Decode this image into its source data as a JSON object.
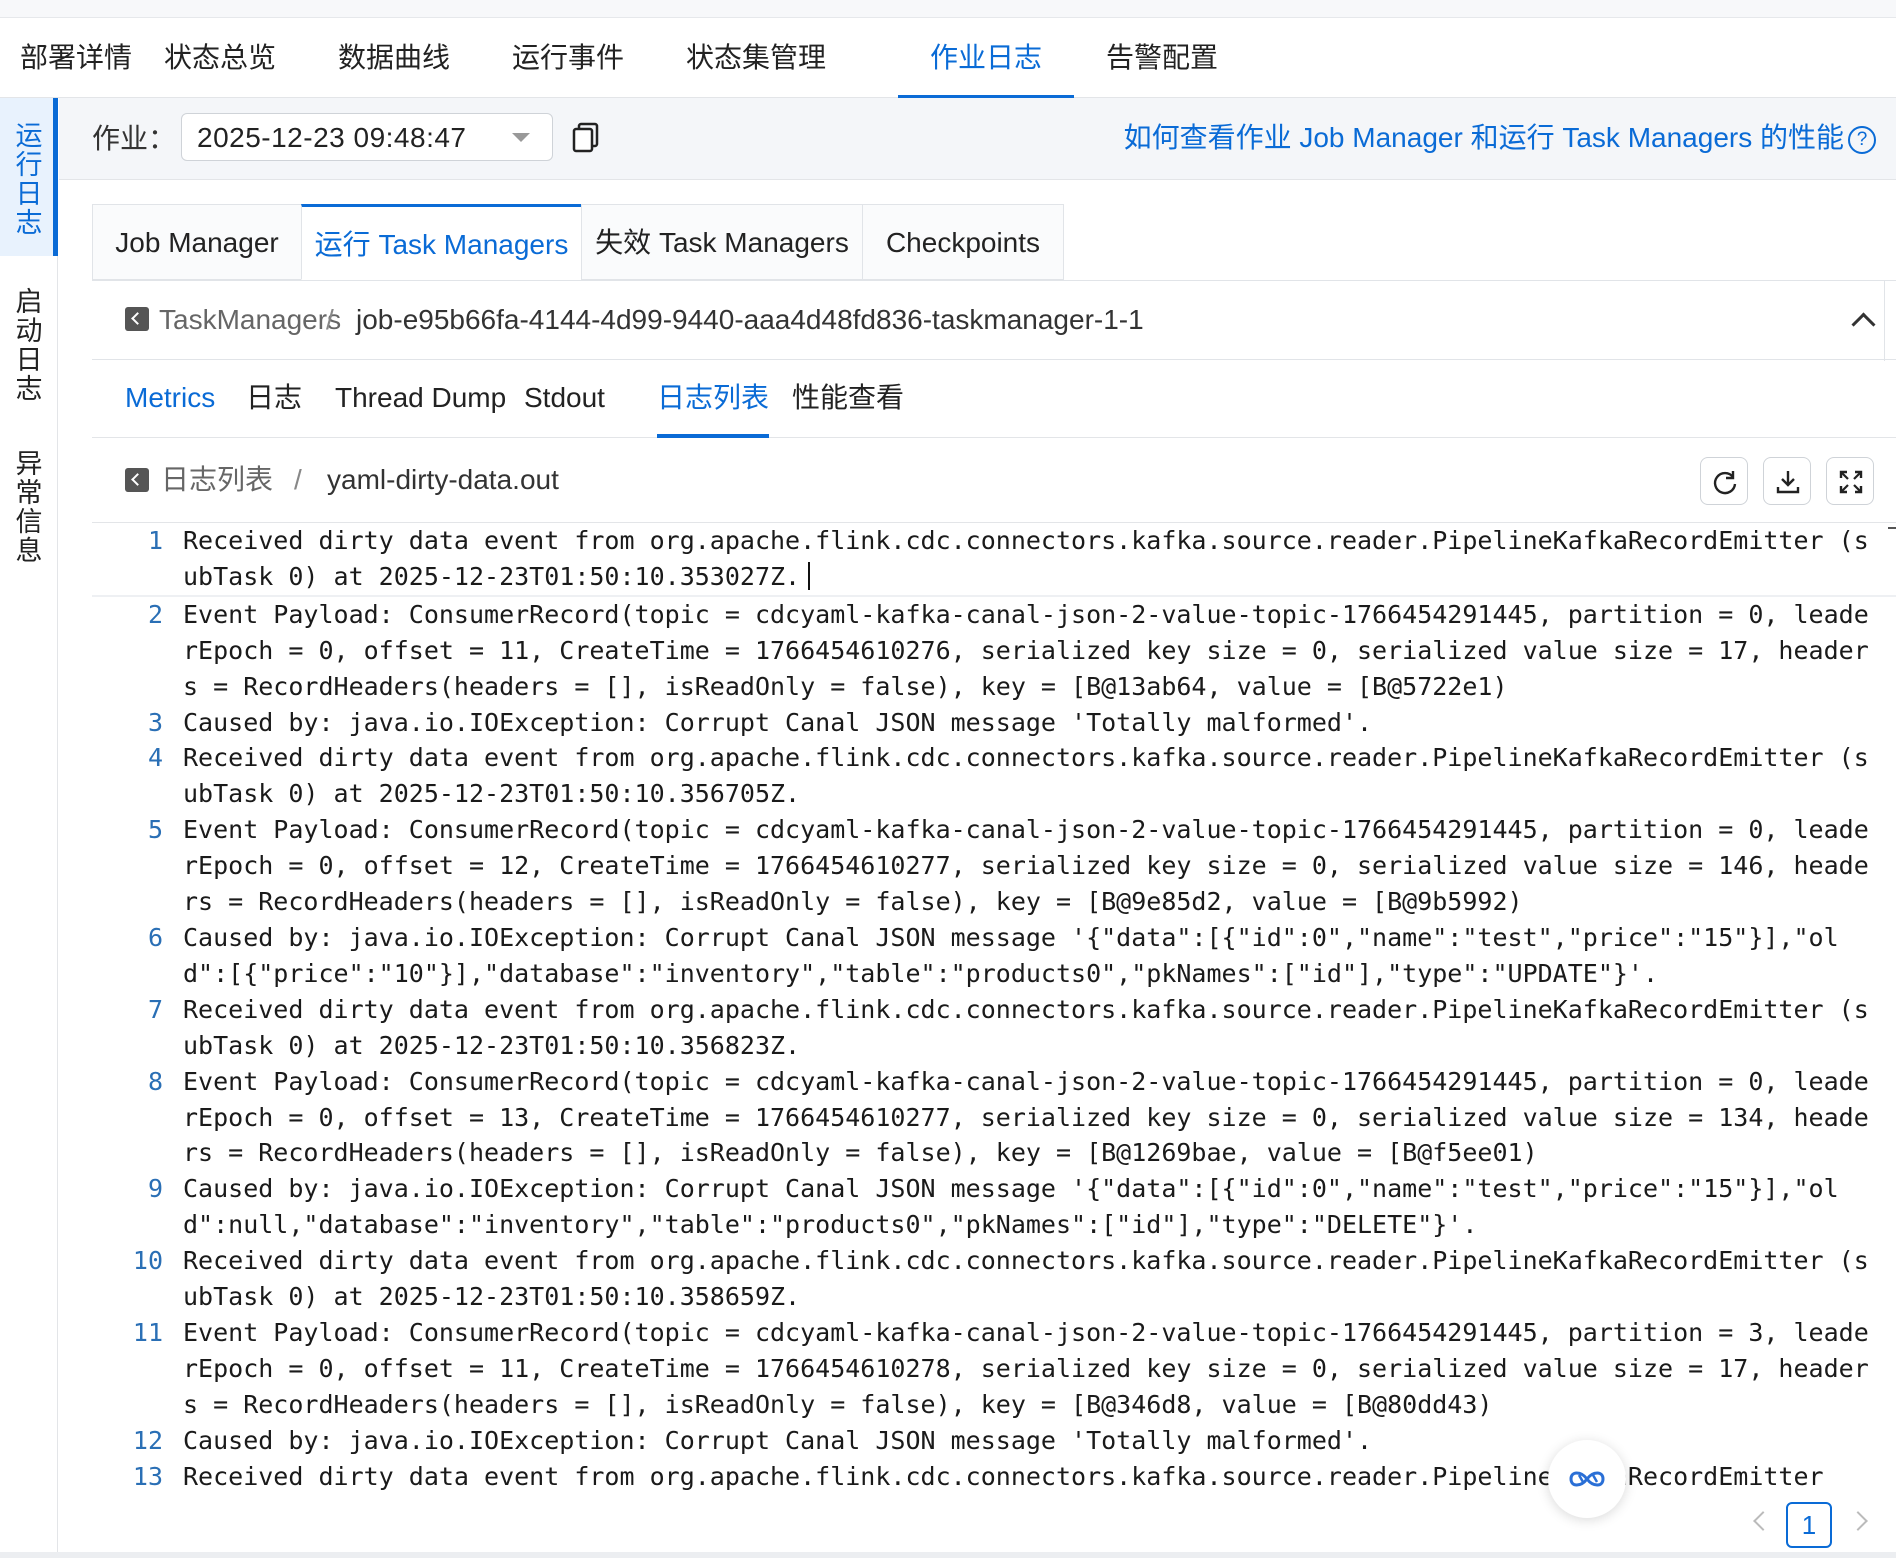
{
  "top_nav": {
    "items": [
      {
        "label": "部署详情"
      },
      {
        "label": "状态总览"
      },
      {
        "label": "数据曲线"
      },
      {
        "label": "运行事件"
      },
      {
        "label": "状态集管理"
      },
      {
        "label": "作业日志",
        "active": true
      },
      {
        "label": "告警配置"
      }
    ]
  },
  "side_nav": {
    "items": [
      {
        "label": "运行日志",
        "active": true
      },
      {
        "label": "启动日志"
      },
      {
        "label": "异常信息"
      }
    ]
  },
  "job_bar": {
    "label": "作业：",
    "selected": "2025-12-23 09:48:47",
    "help_link": "如何查看作业 Job Manager 和运行 Task Managers 的性能",
    "help_icon": "?"
  },
  "tm_tabs": [
    {
      "label": "Job Manager"
    },
    {
      "label": "运行 Task Managers",
      "active": true
    },
    {
      "label": "失效 Task Managers"
    },
    {
      "label": "Checkpoints"
    }
  ],
  "breadcrumb": {
    "parent": "TaskManagers",
    "separator": "/",
    "current": "job-e95b66fa-4144-4d99-9440-aaa4d48fd836-taskmanager-1-1"
  },
  "sub_tabs": [
    {
      "label": "Metrics"
    },
    {
      "label": "日志"
    },
    {
      "label": "Thread Dump"
    },
    {
      "label": "Stdout"
    },
    {
      "label": "日志列表",
      "active": true
    },
    {
      "label": "性能查看"
    }
  ],
  "file_breadcrumb": {
    "parent": "日志列表",
    "separator": "/",
    "current": "yaml-dirty-data.out"
  },
  "log": {
    "lines": [
      {
        "n": "1",
        "text": "Received dirty data event from org.apache.flink.cdc.connectors.kafka.source.reader.PipelineKafkaRecordEmitter (subTask 0) at 2025-12-23T01:50:10.353027Z."
      },
      {
        "n": "2",
        "text": "Event Payload: ConsumerRecord(topic = cdcyaml-kafka-canal-json-2-value-topic-1766454291445, partition = 0, leaderEpoch = 0, offset = 11, CreateTime = 1766454610276, serialized key size = 0, serialized value size = 17, headers = RecordHeaders(headers = [], isReadOnly = false), key = [B@13ab64, value = [B@5722e1)"
      },
      {
        "n": "3",
        "text": "Caused by: java.io.IOException: Corrupt Canal JSON message 'Totally malformed'."
      },
      {
        "n": "4",
        "text": "Received dirty data event from org.apache.flink.cdc.connectors.kafka.source.reader.PipelineKafkaRecordEmitter (subTask 0) at 2025-12-23T01:50:10.356705Z."
      },
      {
        "n": "5",
        "text": "Event Payload: ConsumerRecord(topic = cdcyaml-kafka-canal-json-2-value-topic-1766454291445, partition = 0, leaderEpoch = 0, offset = 12, CreateTime = 1766454610277, serialized key size = 0, serialized value size = 146, headers = RecordHeaders(headers = [], isReadOnly = false), key = [B@9e85d2, value = [B@9b5992)"
      },
      {
        "n": "6",
        "text": "Caused by: java.io.IOException: Corrupt Canal JSON message '{\"data\":[{\"id\":0\",\"name\":\"test\",\"price\":\"15\"}],\"old\":[{\"price\":\"10\"}],\"database\":\"inventory\",\"table\":\"products0\",\"pkNames\":[\"id\"],\"type\":\"UPDATE\"}'."
      },
      {
        "n": "7",
        "text": "Received dirty data event from org.apache.flink.cdc.connectors.kafka.source.reader.PipelineKafkaRecordEmitter (subTask 0) at 2025-12-23T01:50:10.356823Z."
      },
      {
        "n": "8",
        "text": "Event Payload: ConsumerRecord(topic = cdcyaml-kafka-canal-json-2-value-topic-1766454291445, partition = 0, leaderEpoch = 0, offset = 13, CreateTime = 1766454610277, serialized key size = 0, serialized value size = 134, headers = RecordHeaders(headers = [], isReadOnly = false), key = [B@1269bae, value = [B@f5ee01)"
      },
      {
        "n": "9",
        "text": "Caused by: java.io.IOException: Corrupt Canal JSON message '{\"data\":[{\"id\":0\",\"name\":\"test\",\"price\":\"15\"}],\"old\":null,\"database\":\"inventory\",\"table\":\"products0\",\"pkNames\":[\"id\"],\"type\":\"DELETE\"}'."
      },
      {
        "n": "10",
        "text": "Received dirty data event from org.apache.flink.cdc.connectors.kafka.source.reader.PipelineKafkaRecordEmitter (subTask 0) at 2025-12-23T01:50:10.358659Z."
      },
      {
        "n": "11",
        "text": "Event Payload: ConsumerRecord(topic = cdcyaml-kafka-canal-json-2-value-topic-1766454291445, partition = 3, leaderEpoch = 0, offset = 11, CreateTime = 1766454610278, serialized key size = 0, serialized value size = 17, headers = RecordHeaders(headers = [], isReadOnly = false), key = [B@346d8, value = [B@80dd43)"
      },
      {
        "n": "12",
        "text": "Caused by: java.io.IOException: Corrupt Canal JSON message 'Totally malformed'."
      },
      {
        "n": "13",
        "text": "Received dirty data event from org.apache.flink.cdc.connectors.kafka.source.reader.PipelineKafkaRecordEmitter"
      }
    ]
  },
  "pagination": {
    "current": "1"
  },
  "icons": {
    "copy": "copy-icon",
    "back": "back-square-icon",
    "collapse": "chevron-up-icon",
    "refresh": "refresh-icon",
    "download": "download-icon",
    "fullscreen": "fullscreen-icon",
    "assistant": "assistant-icon",
    "help": "help-circle-icon"
  },
  "colors": {
    "accent": "#0a6bd6",
    "line_number": "#2a6fb5"
  }
}
